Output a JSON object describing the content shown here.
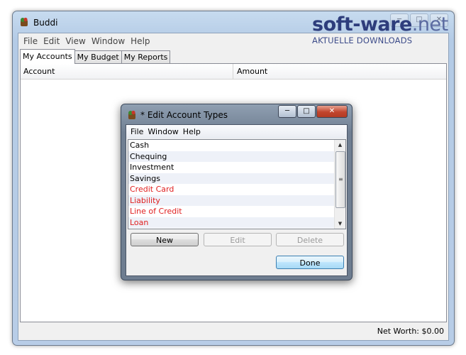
{
  "app": {
    "title": "Buddi"
  },
  "main_menu": [
    "File",
    "Edit",
    "View",
    "Window",
    "Help"
  ],
  "tabs": [
    {
      "label": "My Accounts",
      "active": true
    },
    {
      "label": "My Budget",
      "active": false
    },
    {
      "label": "My Reports",
      "active": false
    }
  ],
  "table": {
    "columns": [
      "Account",
      "Amount"
    ]
  },
  "status": {
    "net_worth": "Net Worth: $0.00"
  },
  "dialog": {
    "title": "* Edit Account Types",
    "menu": [
      "File",
      "Window",
      "Help"
    ],
    "list": [
      {
        "label": "Cash",
        "credit": false
      },
      {
        "label": "Chequing",
        "credit": false
      },
      {
        "label": "Investment",
        "credit": false
      },
      {
        "label": "Savings",
        "credit": false
      },
      {
        "label": "Credit Card",
        "credit": true
      },
      {
        "label": "Liability",
        "credit": true
      },
      {
        "label": "Line of Credit",
        "credit": true
      },
      {
        "label": "Loan",
        "credit": true
      }
    ],
    "buttons": {
      "new": "New",
      "edit": "Edit",
      "delete": "Delete",
      "done": "Done"
    },
    "buttons_enabled": {
      "new": true,
      "edit": false,
      "delete": false,
      "done": true
    }
  },
  "watermark": {
    "logo_bold": "soft-ware",
    "logo_thin": ".net",
    "tagline": "AKTUELLE DOWNLOADS"
  },
  "icons": {
    "app": "buddi-app-icon",
    "minimize": "minimize-icon",
    "maximize": "maximize-icon",
    "close": "close-icon"
  },
  "colors": {
    "credit_text": "#e02020",
    "window_frame": "#b8cde7",
    "dialog_frame": "#6e7d90"
  }
}
